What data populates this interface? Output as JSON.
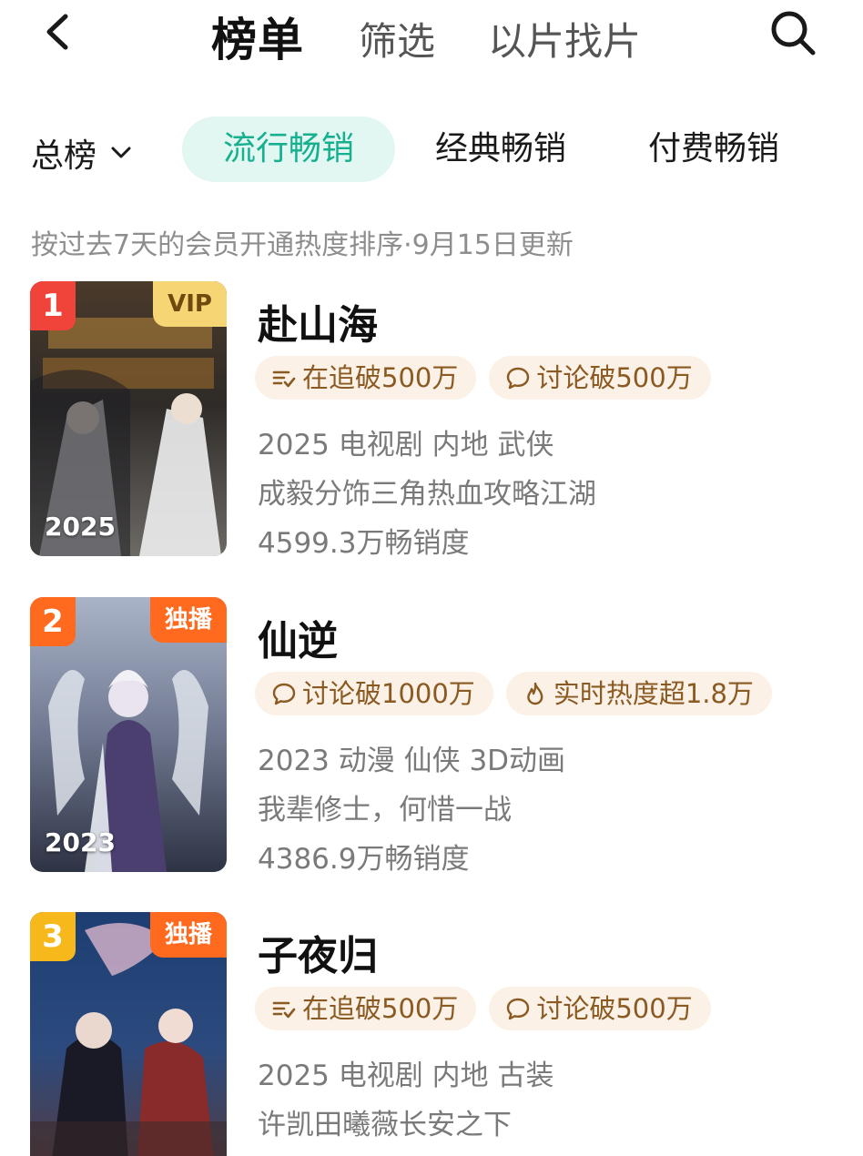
{
  "header": {
    "title": "榜单",
    "filter_label": "筛选",
    "find_by_image_label": "以片找片",
    "back_icon": "chevron-left-icon",
    "search_icon": "search-icon"
  },
  "tabs": {
    "all_label": "总榜",
    "items": [
      {
        "label": "流行畅销",
        "active": true
      },
      {
        "label": "经典畅销",
        "active": false
      },
      {
        "label": "付费畅销",
        "active": false
      }
    ],
    "active_color": "#16b08f",
    "active_bg": "#e2f7f2"
  },
  "subtitle": "按过去7天的会员开通热度排序·9月15日更新",
  "list": [
    {
      "rank": "1",
      "rank_color": "#f0433a",
      "badge": "VIP",
      "poster_year": "2025",
      "title": "赴山海",
      "tags": [
        {
          "icon": "follow-list-icon",
          "label": "在追破500万"
        },
        {
          "icon": "comment-bubble-icon",
          "label": "讨论破500万"
        }
      ],
      "meta": "2025 电视剧 内地 武侠",
      "description": "成毅分饰三角热血攻略江湖",
      "sales": "4599.3万畅销度"
    },
    {
      "rank": "2",
      "rank_color": "#ff6a1f",
      "badge": "独播",
      "poster_year": "2023",
      "title": "仙逆",
      "tags": [
        {
          "icon": "comment-bubble-icon",
          "label": "讨论破1000万"
        },
        {
          "icon": "flame-icon",
          "label": "实时热度超1.8万"
        }
      ],
      "meta": "2023 动漫 仙侠 3D动画",
      "description": "我辈修士，何惜一战",
      "sales": "4386.9万畅销度"
    },
    {
      "rank": "3",
      "rank_color": "#f6b81a",
      "badge": "独播",
      "poster_year": "2025",
      "title": "子夜归",
      "tags": [
        {
          "icon": "follow-list-icon",
          "label": "在追破500万"
        },
        {
          "icon": "comment-bubble-icon",
          "label": "讨论破500万"
        }
      ],
      "meta": "2025 电视剧 内地 古装",
      "description": "许凯田曦薇长安之下",
      "sales": ""
    }
  ]
}
